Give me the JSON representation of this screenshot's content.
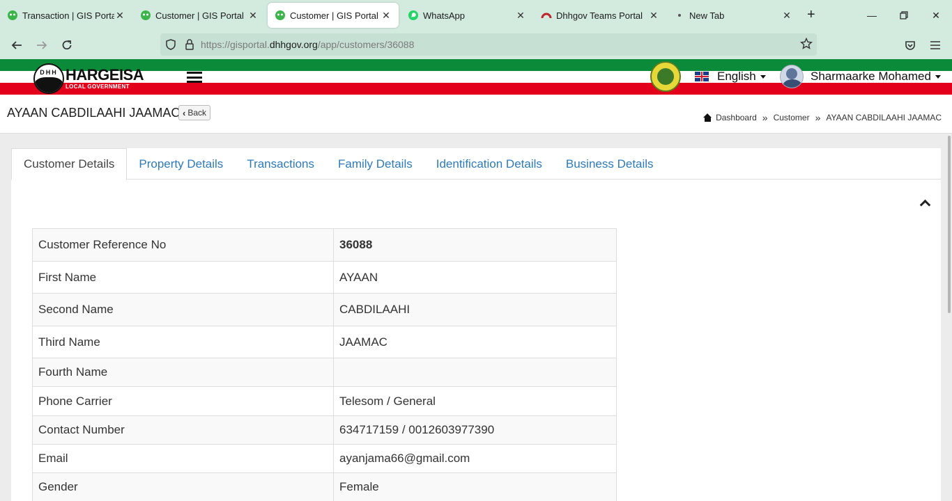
{
  "browser": {
    "tabs": [
      {
        "title": "Transaction | GIS Portal",
        "icon": "gis-icon"
      },
      {
        "title": "Customer | GIS Portal",
        "icon": "gis-icon"
      },
      {
        "title": "Customer | GIS Portal",
        "icon": "gis-icon",
        "active": true
      },
      {
        "title": "WhatsApp",
        "icon": "whatsapp-icon"
      },
      {
        "title": "Dhhgov Teams Portal",
        "icon": "teams-icon"
      },
      {
        "title": "New Tab",
        "icon": "dot-icon"
      }
    ],
    "url_prefix": "https://gisportal.",
    "url_host": "dhhgov.org",
    "url_path": "/app/customers/36088"
  },
  "header": {
    "logo_text": "HARGEISA",
    "logo_subtext": "LOCAL GOVERNMENT",
    "logo_initials": "DHH",
    "language": "English",
    "user_name": "Sharmaarke Mohamed"
  },
  "title_bar": {
    "page_title": "AYAAN CABDILAAHI JAAMAC",
    "back_label": "Back",
    "breadcrumb": [
      "Dashboard",
      "Customer",
      "AYAAN CABDILAAHI JAAMAC"
    ],
    "breadcrumb_sep": "»"
  },
  "tabs": [
    "Customer Details",
    "Property Details",
    "Transactions",
    "Family Details",
    "Identification Details",
    "Business Details"
  ],
  "details": [
    {
      "label": "Customer Reference No",
      "value": "36088"
    },
    {
      "label": "First Name",
      "value": "AYAAN"
    },
    {
      "label": "Second Name",
      "value": "CABDILAAHI"
    },
    {
      "label": "Third Name",
      "value": "JAAMAC"
    },
    {
      "label": "Fourth Name",
      "value": ""
    },
    {
      "label": "Phone Carrier",
      "value": "Telesom / General"
    },
    {
      "label": "Contact Number",
      "value": "634717159 / 0012603977390"
    },
    {
      "label": "Email",
      "value": "ayanjama66@gmail.com"
    },
    {
      "label": "Gender",
      "value": "Female"
    }
  ],
  "colors": {
    "flag_green": "#0b8a3a",
    "flag_red": "#e3001b",
    "link_blue": "#2c7bbb",
    "chrome_bg": "#d3eadf"
  }
}
